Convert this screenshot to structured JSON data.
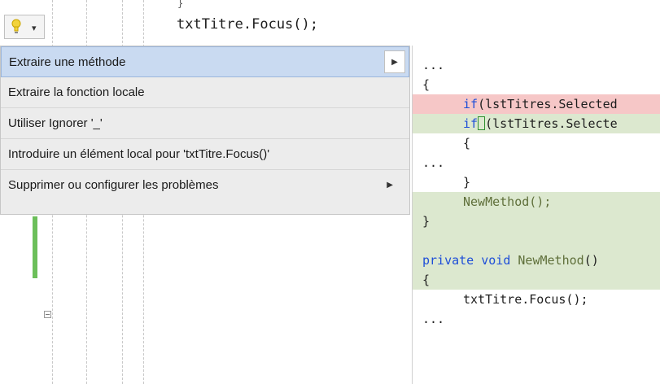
{
  "editor": {
    "top_fragment": "}",
    "top_code_line": "txtTitre.Focus();"
  },
  "lightbulb": {
    "icon": "lightbulb-icon",
    "caret": "▾"
  },
  "menu": {
    "items": [
      {
        "label": "Extraire une méthode",
        "has_submenu": true,
        "selected": true
      },
      {
        "label": "Extraire la fonction locale",
        "has_submenu": false,
        "selected": false
      },
      {
        "label": "Utiliser Ignorer '_'",
        "has_submenu": false,
        "selected": false
      },
      {
        "label": "Introduire un élément local pour 'txtTitre.Focus()'",
        "has_submenu": false,
        "selected": false
      },
      {
        "label": "Supprimer ou configurer les problèmes",
        "has_submenu": true,
        "selected": false
      }
    ],
    "submenu_arrow": "▶"
  },
  "preview": {
    "lines": [
      {
        "text": "...",
        "indent": 0,
        "style": "none"
      },
      {
        "text": "{",
        "indent": 0,
        "style": "none"
      },
      {
        "text": "if(lstTitres.Selected",
        "indent": 1,
        "style": "removed"
      },
      {
        "text": "if (lstTitres.Selecte",
        "indent": 1,
        "style": "added"
      },
      {
        "text": "{",
        "indent": 1,
        "style": "none"
      },
      {
        "text": "...",
        "indent": 0,
        "style": "none"
      },
      {
        "text": "}",
        "indent": 1,
        "style": "none"
      },
      {
        "text": "NewMethod();",
        "indent": 1,
        "style": "added"
      },
      {
        "text": "}",
        "indent": 0,
        "style": "added"
      },
      {
        "text": "",
        "indent": 0,
        "style": "none"
      },
      {
        "text": "private void NewMethod()",
        "indent": 0,
        "style": "added"
      },
      {
        "text": "{",
        "indent": 0,
        "style": "added"
      },
      {
        "text": "txtTitre.Focus();",
        "indent": 1,
        "style": "none"
      },
      {
        "text": "...",
        "indent": 0,
        "style": "none"
      }
    ]
  },
  "colors": {
    "removed_bg": "#f6c7c7",
    "added_bg": "#dce8cf",
    "selected_item_bg": "#c9daf1",
    "keyword": "#1f4fd8"
  }
}
